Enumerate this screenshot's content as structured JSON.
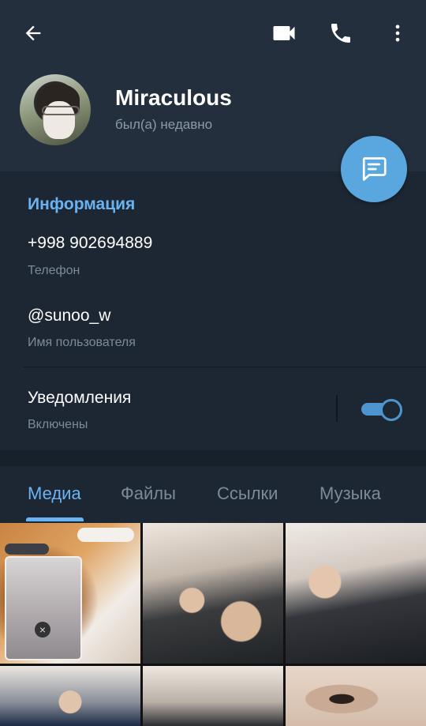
{
  "colors": {
    "accent": "#6ab3f3",
    "fab": "#5aa7e0",
    "header_bg": "#232f3d",
    "body_bg": "#1d2733"
  },
  "topbar": {
    "back_icon": "arrow-left-icon",
    "video_icon": "video-camera-icon",
    "call_icon": "phone-icon",
    "more_icon": "more-vertical-icon"
  },
  "profile": {
    "name": "Miraculous",
    "status": "был(а) недавно"
  },
  "fab": {
    "icon": "message-icon"
  },
  "info": {
    "title": "Информация",
    "phone": "+998 902694889",
    "phone_label": "Телефон",
    "username": "@sunoo_w",
    "username_label": "Имя пользователя",
    "notifications": "Уведомления",
    "notifications_state": "Включены",
    "notifications_enabled": true
  },
  "tabs": [
    "Медиа",
    "Файлы",
    "Ссылки",
    "Музыка"
  ],
  "active_tab": "Медиа",
  "media_count_visible": 6
}
